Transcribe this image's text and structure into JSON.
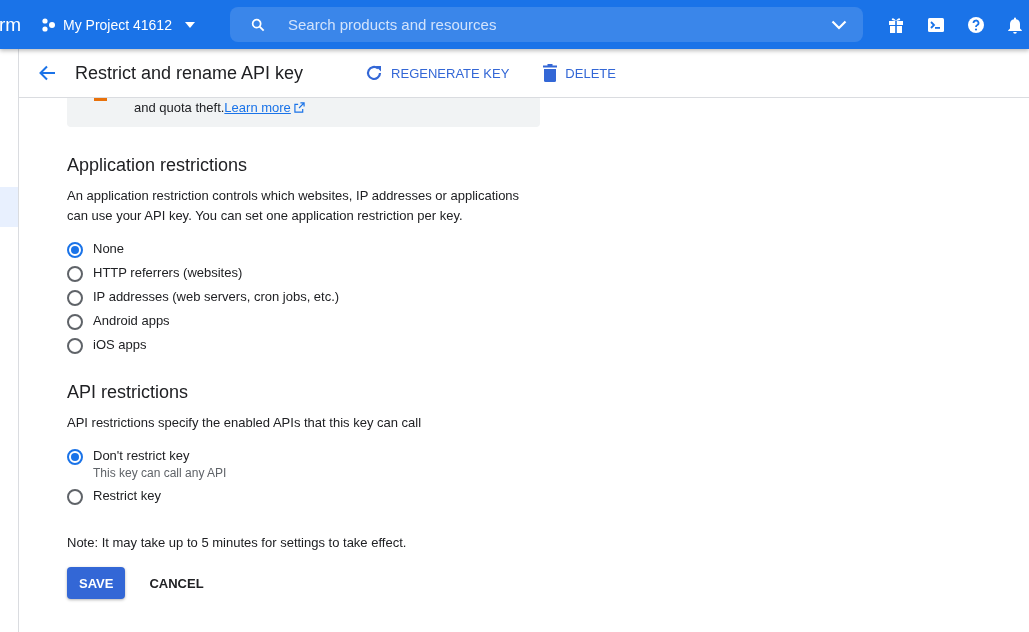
{
  "top_bar": {
    "product_fragment": "rm",
    "project": "My Project 41612",
    "search": {
      "placeholder": "Search products and resources"
    }
  },
  "header": {
    "title": "Restrict and rename API key",
    "actions": [
      {
        "label": "REGENERATE KEY",
        "kind": "regenerate"
      },
      {
        "label": "DELETE",
        "kind": "delete"
      }
    ]
  },
  "notice": {
    "text": "and quota theft.",
    "link": "Learn more"
  },
  "application_restrictions": {
    "title": "Application restrictions",
    "description": "An application restriction controls which websites, IP addresses or applications can use your API key. You can set one application restriction per key.",
    "options": [
      {
        "label": "None",
        "selected": true
      },
      {
        "label": "HTTP referrers (websites)",
        "selected": false
      },
      {
        "label": "IP addresses (web servers, cron jobs, etc.)",
        "selected": false
      },
      {
        "label": "Android apps",
        "selected": false
      },
      {
        "label": "iOS apps",
        "selected": false
      }
    ]
  },
  "api_restrictions": {
    "title": "API restrictions",
    "description": "API restrictions specify the enabled APIs that this key can call",
    "options": [
      {
        "label": "Don't restrict key",
        "hint": "This key can call any API",
        "selected": true
      },
      {
        "label": "Restrict key",
        "selected": false
      }
    ]
  },
  "note": "Note: It may take up to 5 minutes for settings to take effect.",
  "buttons": [
    {
      "label": "SAVE",
      "kind": "primary"
    },
    {
      "label": "CANCEL",
      "kind": "text"
    }
  ]
}
